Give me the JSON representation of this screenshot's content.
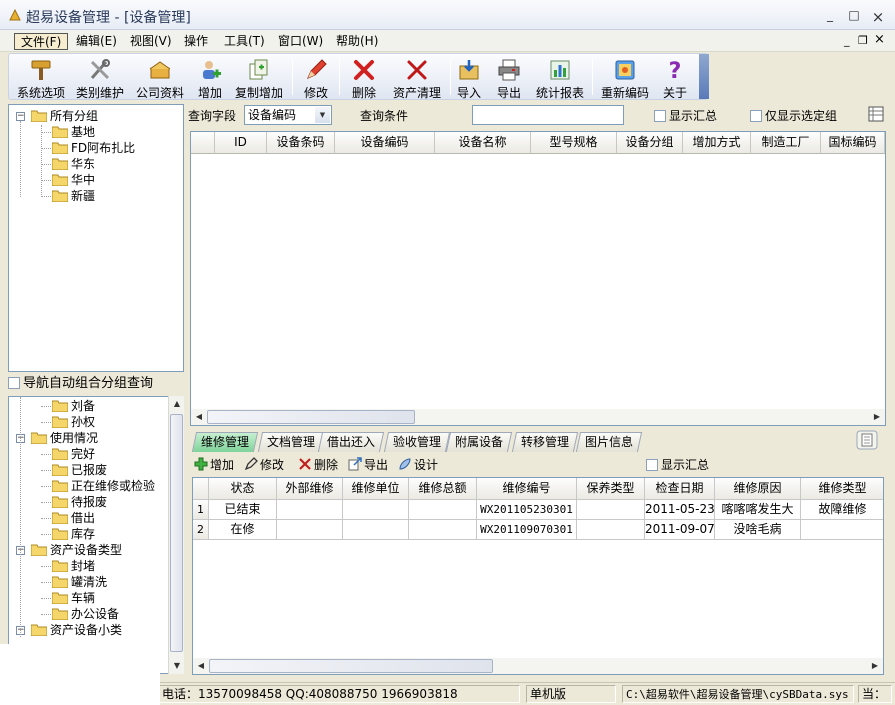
{
  "window": {
    "title": "超易设备管理 - [设备管理]",
    "min": "_",
    "max": "□",
    "close": "×"
  },
  "menu": {
    "items": [
      "文件(F)",
      "编辑(E)",
      "视图(V)",
      "操作",
      "工具(T)",
      "窗口(W)",
      "帮助(H)"
    ],
    "mdi_min": "_",
    "mdi_restore": "❐",
    "mdi_close": "×"
  },
  "toolbar": {
    "buttons": [
      "系统选项",
      "类别维护",
      "公司资料",
      "增加",
      "复制增加",
      "修改",
      "删除",
      "资产清理",
      "导入",
      "导出",
      "统计报表",
      "重新编码",
      "关于"
    ]
  },
  "tree_top": {
    "root": "所有分组",
    "children": [
      "基地",
      "FD阿布扎比",
      "华东",
      "华中",
      "新疆"
    ]
  },
  "nav_group_label": "导航自动组合分组查询",
  "tree_bottom": {
    "rows": [
      {
        "text": "刘备",
        "level": 1
      },
      {
        "text": "孙权",
        "level": 1
      },
      {
        "text": "使用情况",
        "level": 0
      },
      {
        "text": "完好",
        "level": 1
      },
      {
        "text": "已报废",
        "level": 1
      },
      {
        "text": "正在维修或检验",
        "level": 1
      },
      {
        "text": "待报废",
        "level": 1
      },
      {
        "text": "借出",
        "level": 1
      },
      {
        "text": "库存",
        "level": 1
      },
      {
        "text": "资产设备类型",
        "level": 0
      },
      {
        "text": "封堵",
        "level": 1
      },
      {
        "text": "罐清洗",
        "level": 1
      },
      {
        "text": "车辆",
        "level": 1
      },
      {
        "text": "办公设备",
        "level": 1
      },
      {
        "text": "资产设备小类",
        "level": 0
      }
    ]
  },
  "query": {
    "field_label": "查询字段",
    "field_value": "设备编码",
    "cond_label": "查询条件",
    "cond_value": "",
    "show_summary": "显示汇总",
    "show_selected": "仅显示选定组"
  },
  "main_grid": {
    "columns": [
      "",
      "ID",
      "设备条码",
      "设备编码",
      "设备名称",
      "型号规格",
      "设备分组",
      "增加方式",
      "制造工厂",
      "国标编码"
    ]
  },
  "tabs": [
    "维修管理",
    "文档管理",
    "借出还入",
    "验收管理",
    "附属设备",
    "转移管理",
    "图片信息"
  ],
  "sub_toolbar": {
    "add": "增加",
    "edit": "修改",
    "delete": "删除",
    "export": "导出",
    "design": "设计",
    "show_summary": "显示汇总"
  },
  "detail_grid": {
    "columns": [
      "",
      "状态",
      "外部维修",
      "维修单位",
      "维修总额",
      "维修编号",
      "保养类型",
      "检查日期",
      "维修原因",
      "维修类型"
    ],
    "rows": [
      [
        "1",
        "已结束",
        "",
        "",
        "",
        "WX201105230301",
        "",
        "2011-05-23",
        "喀喀喀发生大",
        "故障维修"
      ],
      [
        "2",
        "在修",
        "",
        "",
        "",
        "WX201109070301",
        "",
        "2011-09-07",
        "没啥毛病",
        ""
      ]
    ]
  },
  "statusbar": {
    "contact": "电话：13570098458 QQ:408088750 1966903818",
    "edition": "单机版",
    "path": "C:\\超易软件\\超易设备管理\\cySBData.sys",
    "extra": "当："
  },
  "colors": {
    "active_tab": "#7fd39b",
    "border": "#7f9db9",
    "window_bg": "#ECE9D8"
  }
}
